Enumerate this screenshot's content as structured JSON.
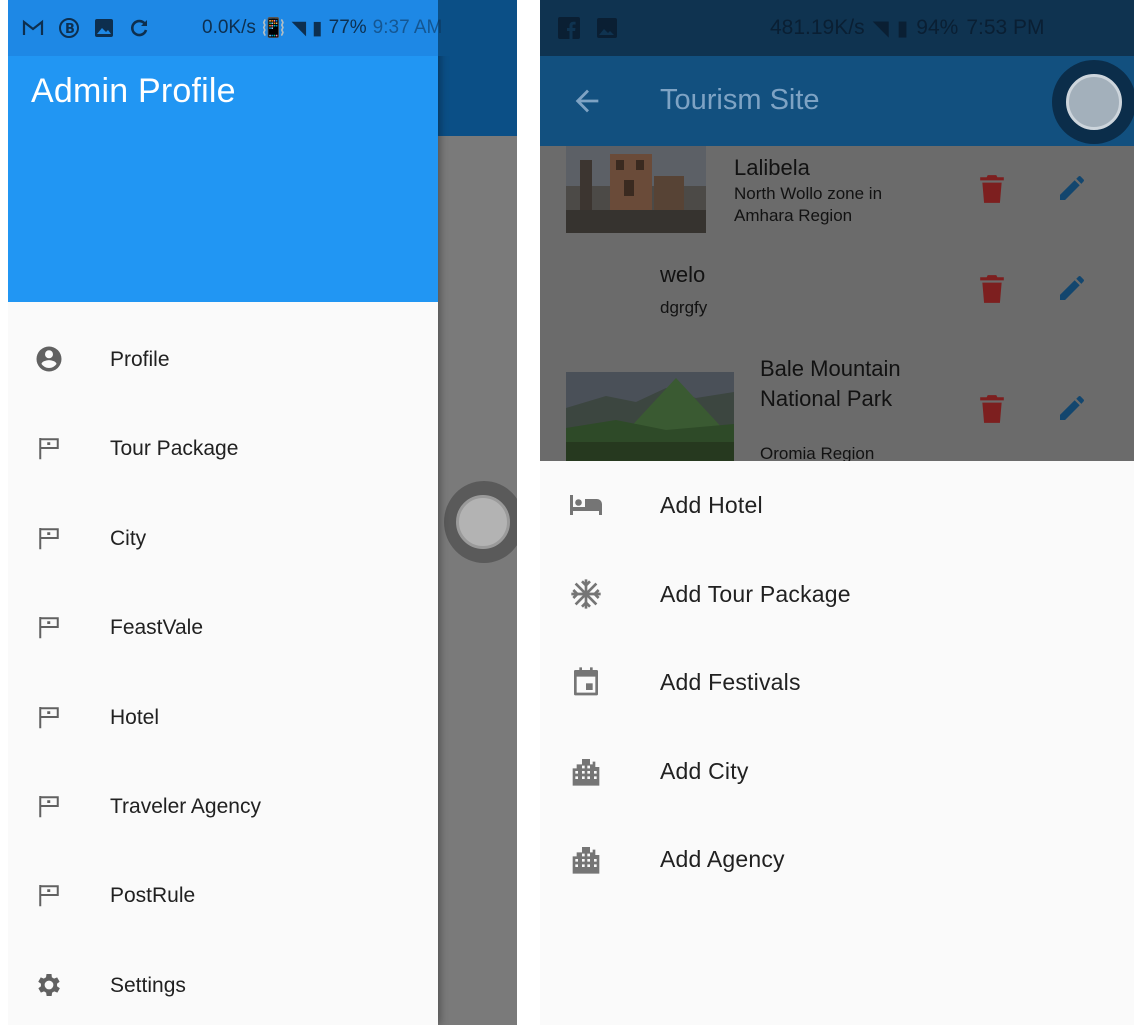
{
  "left": {
    "status_bar": {
      "speed": "0.0K/s",
      "battery": "77%",
      "time": "9:37 AM"
    },
    "drawer": {
      "title": "Admin Profile",
      "items": [
        {
          "label": "Profile",
          "icon": "account-circle-icon"
        },
        {
          "label": "Tour Package",
          "icon": "flag-icon"
        },
        {
          "label": "City",
          "icon": "flag-icon"
        },
        {
          "label": "FeastVale",
          "icon": "flag-icon"
        },
        {
          "label": "Hotel",
          "icon": "flag-icon"
        },
        {
          "label": "Traveler Agency",
          "icon": "flag-icon"
        },
        {
          "label": "PostRule",
          "icon": "flag-icon"
        },
        {
          "label": "Settings",
          "icon": "gear-icon"
        }
      ]
    }
  },
  "right": {
    "status_bar": {
      "speed": "481.19K/s",
      "battery": "94%",
      "time": "7:53 PM"
    },
    "appbar": {
      "title": "Tourism Site"
    },
    "sites": [
      {
        "name": "Lalibela",
        "subtitle": "North Wollo zone in Amhara Region"
      },
      {
        "name": "welo",
        "subtitle": "dgrgfy"
      },
      {
        "name": "Bale Mountain National Park",
        "subtitle": "Oromia Region"
      }
    ],
    "sheet": {
      "items": [
        {
          "label": "Add Hotel",
          "icon": "hotel-bed-icon"
        },
        {
          "label": "Add Tour Package",
          "icon": "snowflake-icon"
        },
        {
          "label": "Add Festivals",
          "icon": "calendar-icon"
        },
        {
          "label": "Add City",
          "icon": "city-building-icon"
        },
        {
          "label": "Add Agency",
          "icon": "city-building-icon"
        }
      ]
    }
  },
  "colors": {
    "drawer_header": "#2196f3",
    "appbar": "#12507f",
    "delete": "#c62828",
    "edit": "#1565c0"
  }
}
